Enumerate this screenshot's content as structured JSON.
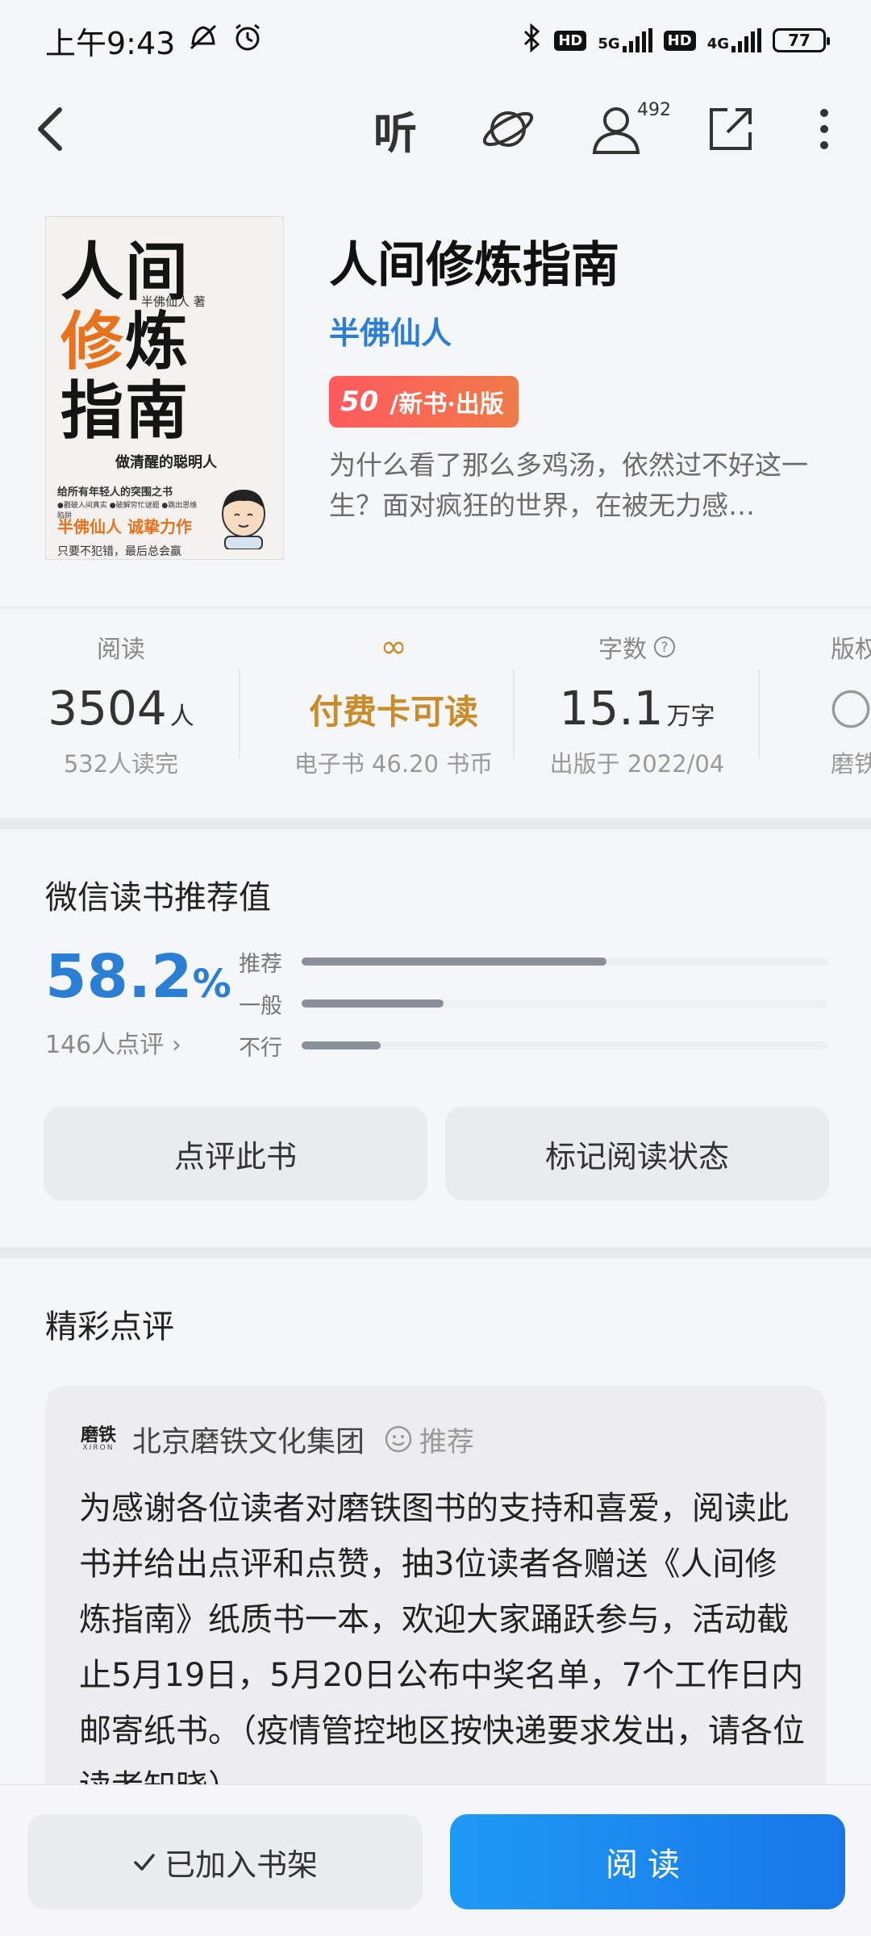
{
  "status_bar": {
    "time": "上午9:43",
    "hd1": "HD",
    "net1": "5G",
    "hd2": "HD",
    "net2": "4G",
    "battery": "77"
  },
  "nav": {
    "listen_label": "听",
    "follow_count": "492",
    "icons": [
      "back-icon",
      "planet-icon",
      "person-icon",
      "share-icon",
      "more-icon"
    ]
  },
  "book": {
    "title": "人间修炼指南",
    "author": "半佛仙人",
    "badge_number": "50",
    "badge_text": "/新书·出版",
    "description": "为什么看了那么多鸡汤，依然过不好这一生？面对疯狂的世界，在被无力感…",
    "cover": {
      "line1": "人间",
      "line2a": "修",
      "line2b": "炼",
      "line3": "指南",
      "author": "半佛仙人 著",
      "subtitle": "做清醒的聪明人",
      "tagline": "给所有年轻人的突围之书",
      "bullets": "●戳破人间真实 ●破解穷忙谜题 ●跳出思维陷阱",
      "emphasis": "半佛仙人 诚挚力作",
      "motto": "只要不犯错，最后总会赢"
    }
  },
  "stats": {
    "reads": {
      "label": "阅读",
      "value": "3504",
      "unit": "人",
      "sub": "532人读完"
    },
    "access": {
      "label": "∞",
      "value": "付费卡可读",
      "sub": "电子书 46.20 书币"
    },
    "words": {
      "label": "字数",
      "value": "15.1",
      "unit": "万字",
      "sub": "出版于 2022/04"
    },
    "rights": {
      "label": "版权",
      "sub": "磨铁"
    }
  },
  "recommend": {
    "title": "微信读书推荐值",
    "value": "58.2",
    "unit": "%",
    "count": "146人点评",
    "bars": [
      {
        "label": "推荐",
        "ratio": 0.58
      },
      {
        "label": "一般",
        "ratio": 0.27
      },
      {
        "label": "不行",
        "ratio": 0.15
      }
    ]
  },
  "actions": {
    "review_btn": "点评此书",
    "status_btn": "标记阅读状态"
  },
  "reviews": {
    "title": "精彩点评",
    "card": {
      "logo": "磨铁",
      "logo_sub": "XIRON",
      "org": "北京磨铁文化集团",
      "tag": "推荐",
      "body": "为感谢各位读者对磨铁图书的支持和喜爱，阅读此书并给出点评和点赞，抽3位读者各赠送《人间修炼指南》纸质书一本，欢迎大家踊跃参与，活动截止5月19日，5月20日公布中奖名单，7个工作日内邮寄纸书。（疫情管控地区按快递要求发出，请各位读者知晓）"
    }
  },
  "bottom": {
    "shelf": "已加入书架",
    "read": "阅读"
  },
  "colors": {
    "accent_blue": "#2a7fd4",
    "read_button": "#1877e8",
    "orange": "#c98c2a",
    "badge": "#ff5a5f"
  }
}
